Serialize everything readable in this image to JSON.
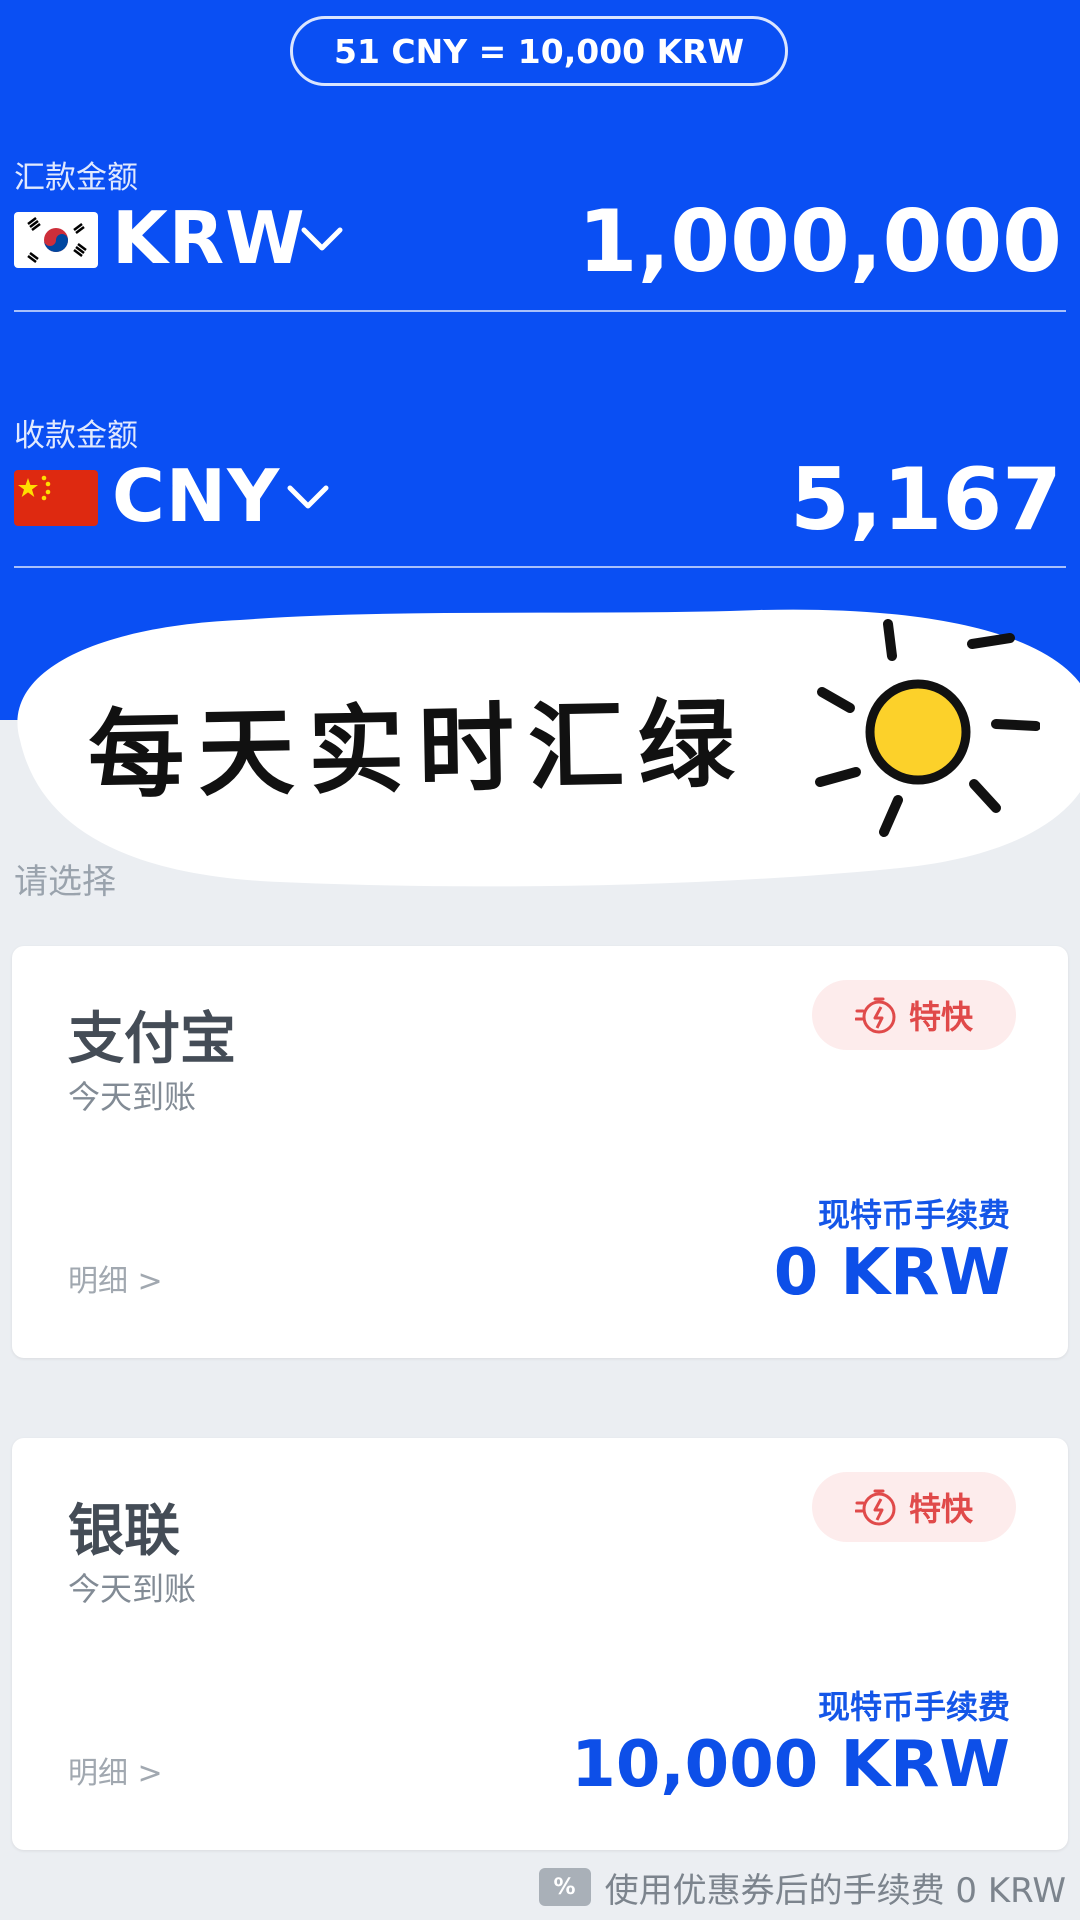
{
  "rate_pill": "51 CNY = 10,000 KRW",
  "send": {
    "label": "汇款金额",
    "currency": "KRW",
    "amount": "1,000,000"
  },
  "receive": {
    "label": "收款金额",
    "currency": "CNY",
    "amount": "5,167"
  },
  "overlay_text": "每天实时汇绿",
  "select_label": "请选择",
  "methods": [
    {
      "name": "支付宝",
      "arrival": "今天到账",
      "badge": "特快",
      "fee_label": "现特币手续费",
      "fee_value": "0 KRW",
      "detail": "明细 >"
    },
    {
      "name": "银联",
      "arrival": "今天到账",
      "badge": "特快",
      "fee_label": "现特币手续费",
      "fee_value": "10,000 KRW",
      "detail": "明细 >"
    }
  ],
  "coupon_text": "使用优惠券后的手续费 0 KRW",
  "colors": {
    "primary_blue": "#0a4ff3",
    "badge_red": "#e04a4a",
    "fee_blue": "#0d4fe8"
  }
}
